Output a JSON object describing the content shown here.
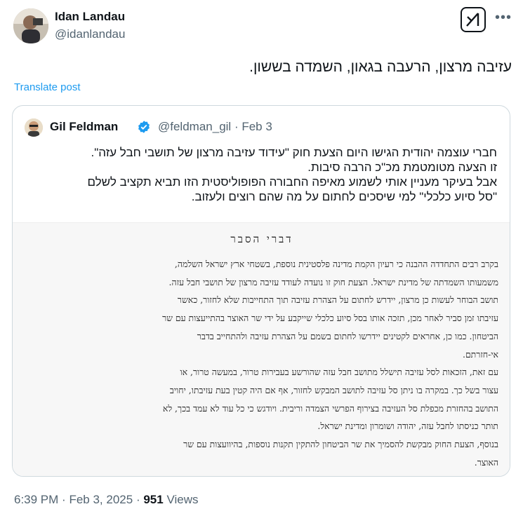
{
  "author": {
    "name": "Idan Landau",
    "handle": "@idanlandau"
  },
  "icons": {
    "grok": "grok-icon",
    "more": "more-icon"
  },
  "tweet": {
    "text": "עזיבה מרצון, הרעבה בגאון, השמדה בששון.",
    "translate_label": "Translate post"
  },
  "quoted": {
    "name": "Gil Feldman",
    "handle": "@feldman_gil",
    "separator": "·",
    "date": "Feb 3",
    "verified_color": "#1d9bf0",
    "text_lines": [
      "חברי עוצמה יהודית הגישו היום הצעת חוק \"עידוד עזיבה מרצון של תושבי חבל עזה\".",
      "זו הצעה מטומטמת מכ\"כ הרבה סיבות.",
      "אבל בעיקר מעניין אותי לשמוע מאיפה החבורה הפופוליסטית הזו תביא תקציב לשלם",
      "\"סל סיוע כלכלי\" למי שיסכים לחתום על מה שהם רוצים ולעזוב."
    ],
    "doc": {
      "title": "דברי הסבר",
      "p1": [
        "בקרב רבים התחדדה ההבנה כי רעיון הקמת מדינה פלסטינית נוספת, בשטחי ארץ ישראל השלמה,",
        "משמעותו השמדתה של מדינת ישראל. הצעת חוק זו נועדה לעודד עזיבה מרצון של תושבי חבל עזה.",
        "תושב הבוחר לעשות כן מרצון, יידרש לחתום על הצהרת עזיבה תוך התחייבות שלא לחזור, כאשר",
        "עזיבתו זמן סביר לאחר מכן, תזכה אותו בסל סיוע כלכלי שייקבע על ידי שר האוצר בהתייעצות עם שר",
        "הביטחון. כמו כן, אחראים לקטינים יידרשו לחתום בשמם על הצהרת עזיבה ולהתחייב בדבר",
        "אי-חזרתם."
      ],
      "p2": [
        "עם זאת, הזכאות לסל עזיבה תישלל מתושב חבל עזה שהורשע בעבירות טרור, במעשה טרור, או",
        "עצור בשל כך. במקרה בו ניתן סל עזיבה לתושב המבקש לחזור, אף אם היה קטין בעת עזיבתו, יחויב",
        "התושב בהחזרת מכפלת סל העזיבה בצירוף הפרשי הצמדה וריבית. ויודגש כי כל עוד לא עמד בכך, לא",
        "תותר כניסתו לחבל עזה, יהודה ושומרון ומדינת ישראל."
      ],
      "p3": [
        "בנוסף, הצעת החוק מבקשת להסמיך את שר הביטחון להתקין תקנות נוספות, בהיוועצות עם שר",
        "האוצר."
      ]
    }
  },
  "meta": {
    "time": "6:39 PM",
    "sep1": "·",
    "date": "Feb 3, 2025",
    "sep2": "·",
    "views_count": "951",
    "views_label": "Views"
  }
}
